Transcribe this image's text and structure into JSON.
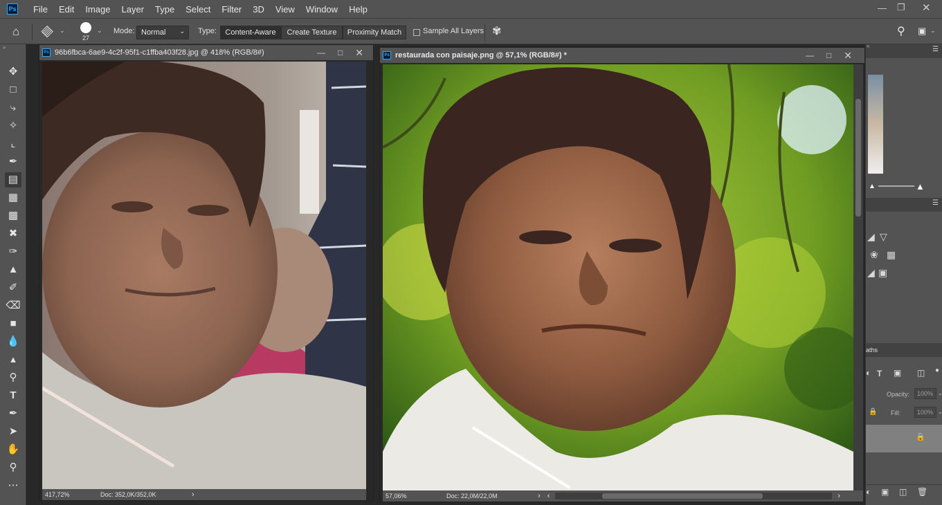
{
  "menubar": {
    "logo": "Ps",
    "items": [
      "File",
      "Edit",
      "Image",
      "Layer",
      "Type",
      "Select",
      "Filter",
      "3D",
      "View",
      "Window",
      "Help"
    ]
  },
  "optionsbar": {
    "brush_size": "27",
    "mode_label": "Mode:",
    "mode_value": "Normal",
    "type_label": "Type:",
    "type_options": [
      "Content-Aware",
      "Create Texture",
      "Proximity Match"
    ],
    "type_selected": "Content-Aware",
    "sample_all_layers": "Sample All Layers"
  },
  "documents": [
    {
      "title": "96b6fbca-6ae9-4c2f-95f1-c1ffba403f28.jpg @ 418% (RGB/8#)",
      "zoom": "417,72%",
      "doc_size": "Doc: 352,0K/352,0K"
    },
    {
      "title": "restaurada con paisaje.png @ 57,1% (RGB/8#) *",
      "zoom": "57,06%",
      "doc_size": "Doc: 22,0M/22,0M"
    }
  ],
  "rightpanel": {
    "paths_tab": "aths",
    "opacity_label": "Opacity:",
    "opacity_value": "100%",
    "fill_label": "Fill:",
    "fill_value": "100%"
  },
  "colors": {
    "ui_bg": "#535353",
    "workspace": "#282828",
    "accent": "#31a8ff"
  }
}
